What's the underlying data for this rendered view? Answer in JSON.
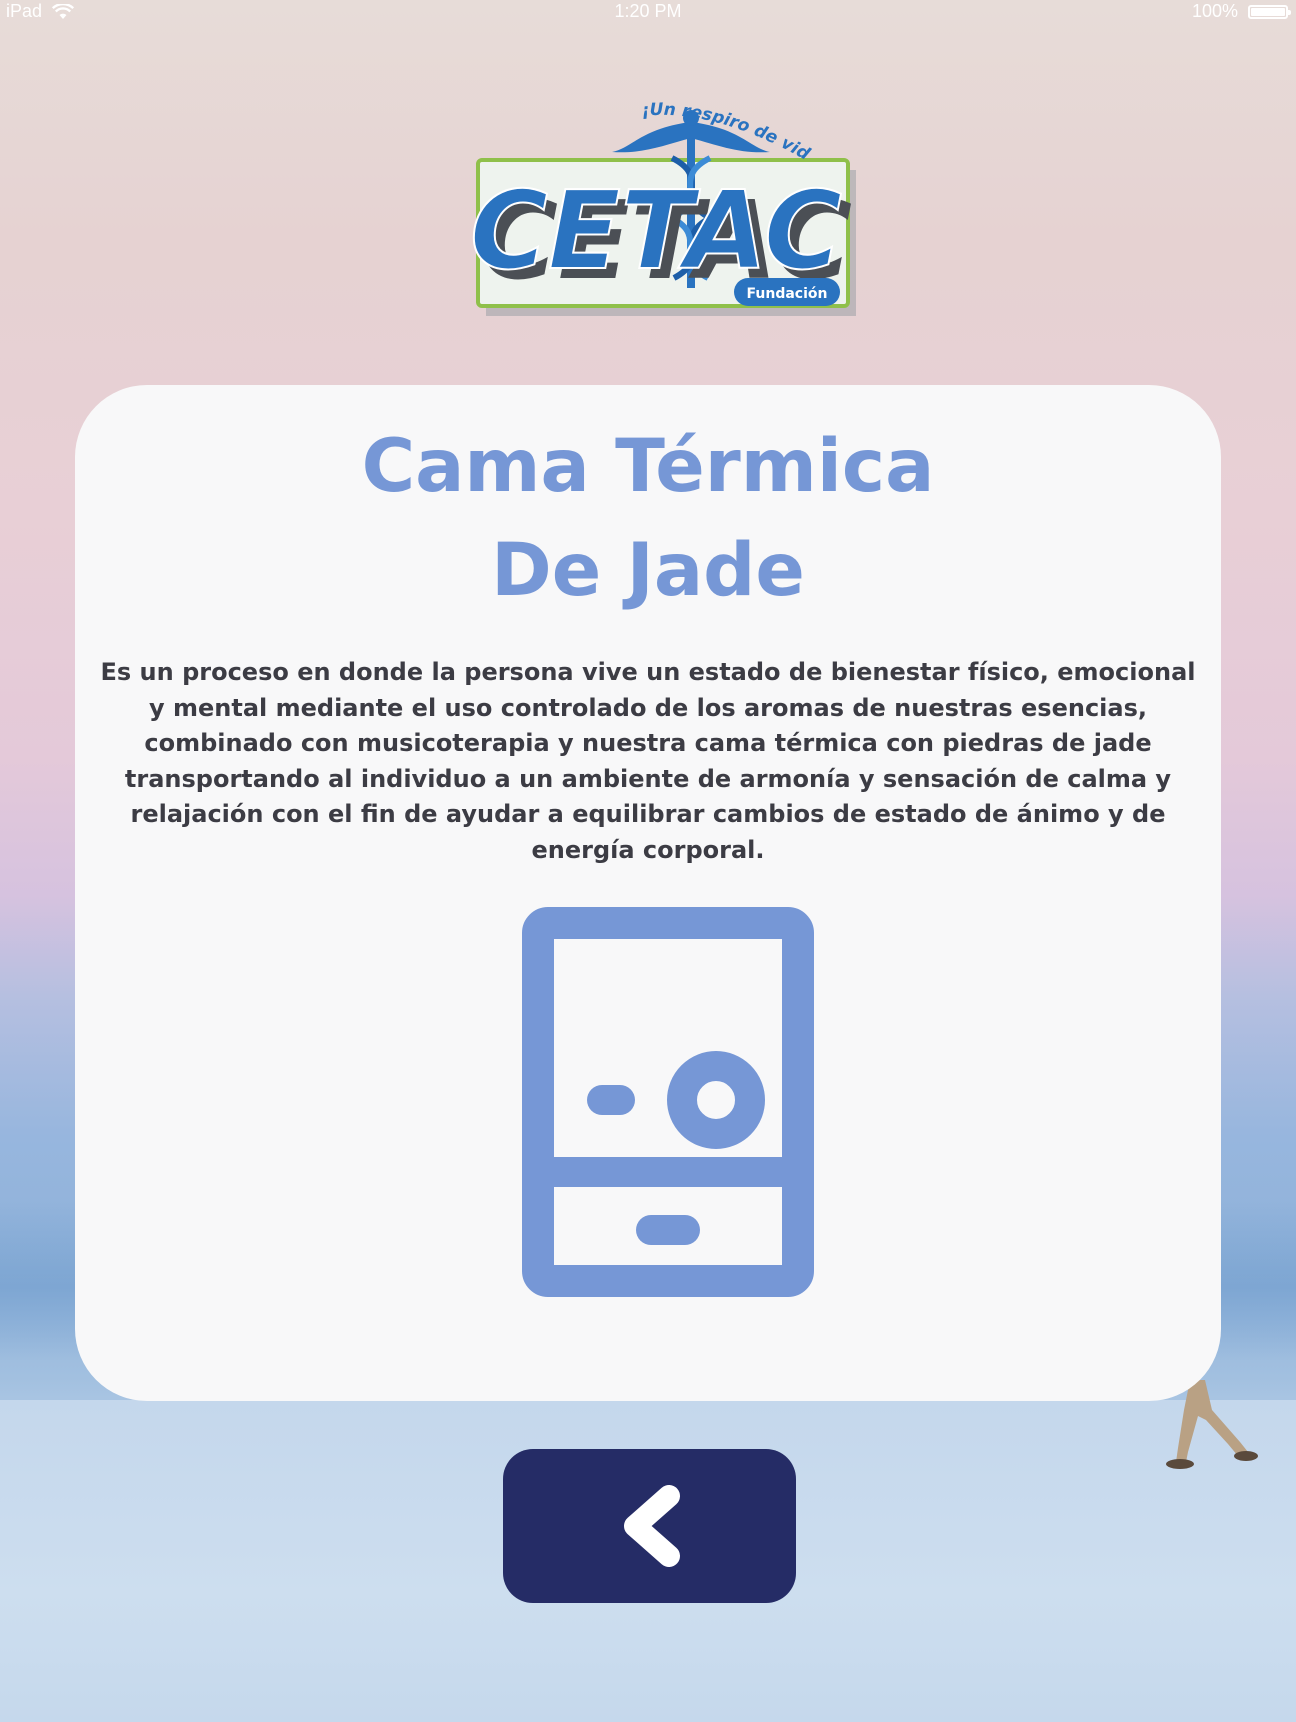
{
  "status_bar": {
    "device": "iPad",
    "time": "1:20 PM",
    "battery": "100%",
    "battery_level": 1.0
  },
  "logo": {
    "tagline": "¡Un respiro de vida!",
    "name": "CETAC",
    "subtitle": "Fundación",
    "icon": "caduceus-icon"
  },
  "card": {
    "title_line1": "Cama Térmica",
    "title_line2": "De Jade",
    "description": "Es un proceso en donde la persona vive un estado de bienestar físico, emocional y mental mediante el uso controlado de los aromas de nuestras esencias, combinado con musicoterapia y nuestra cama térmica con piedras de jade transportando al individuo a un ambiente de armonía y sensación de calma y relajación con el fin de ayudar a equilibrar cambios de estado de ánimo y de energía corporal.",
    "icon": "thermal-device-icon"
  },
  "back_button": {
    "icon": "chevron-left-icon"
  },
  "colors": {
    "accent": "#7697d6",
    "button": "#252c66",
    "card": "#f8f8f9",
    "text": "#3c3c44",
    "logo_blue": "#2a73c0",
    "logo_green": "#8fc04a"
  }
}
